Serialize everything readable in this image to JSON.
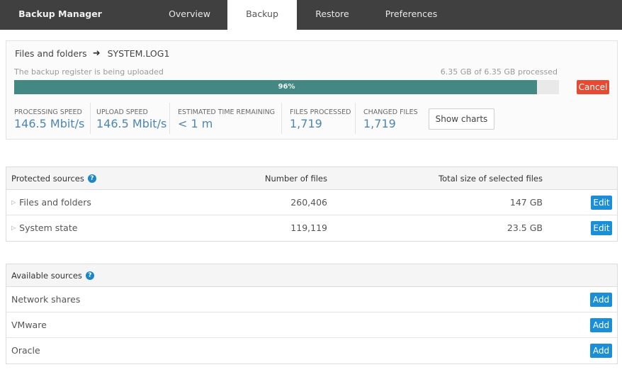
{
  "nav": {
    "brand": "Backup Manager",
    "tabs": [
      {
        "label": "Overview",
        "active": false
      },
      {
        "label": "Backup",
        "active": true
      },
      {
        "label": "Restore",
        "active": false
      },
      {
        "label": "Preferences",
        "active": false
      }
    ]
  },
  "progress": {
    "breadcrumb": {
      "source": "Files and folders",
      "separator_icon": "arrow-right-icon",
      "current_file": "SYSTEM.LOG1"
    },
    "status_text": "The backup register is being uploaded",
    "processed_text": "6.35 GB of 6.35 GB processed",
    "percent": 96,
    "percent_label": "96%",
    "cancel_label": "Cancel",
    "colors": {
      "bar": "#438883",
      "cancel": "#e64a33"
    },
    "stats": [
      {
        "label": "PROCESSING SPEED",
        "value": "146.5 Mbit/s"
      },
      {
        "label": "UPLOAD SPEED",
        "value": "146.5 Mbit/s"
      },
      {
        "label": "ESTIMATED TIME REMAINING",
        "value": "< 1 m"
      },
      {
        "label": "FILES PROCESSED",
        "value": "1,719"
      },
      {
        "label": "CHANGED FILES",
        "value": "1,719"
      }
    ],
    "show_charts_label": "Show charts"
  },
  "protected_sources": {
    "title": "Protected sources",
    "help_icon": "question-circle-icon",
    "columns": [
      "Number of files",
      "Total size of selected files"
    ],
    "rows": [
      {
        "name": "Files and folders",
        "files": "260,406",
        "size": "147 GB",
        "action": "Edit"
      },
      {
        "name": "System state",
        "files": "119,119",
        "size": "23.5 GB",
        "action": "Edit"
      }
    ]
  },
  "available_sources": {
    "title": "Available sources",
    "help_icon": "question-circle-icon",
    "rows": [
      {
        "name": "Network shares",
        "action": "Add"
      },
      {
        "name": "VMware",
        "action": "Add"
      },
      {
        "name": "Oracle",
        "action": "Add"
      }
    ]
  },
  "accent_color": "#1a8fd8"
}
